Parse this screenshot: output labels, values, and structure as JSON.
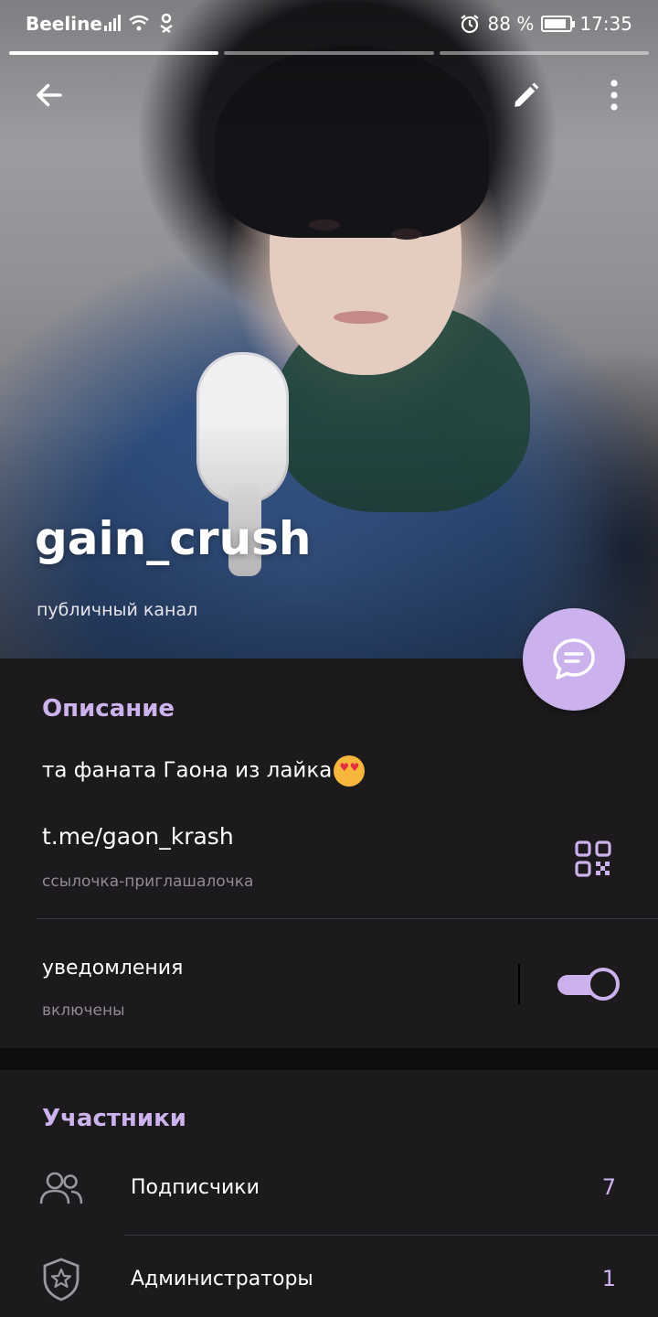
{
  "status_bar": {
    "carrier": "Beeline",
    "battery_percent": "88 %",
    "battery_level": 0.88,
    "time": "17:35"
  },
  "story_progress": {
    "segments": 3,
    "active_index": 0
  },
  "header": {
    "title": "gain_crush",
    "subtitle": "публичный канал"
  },
  "info": {
    "section_title": "Описание",
    "description": "та фаната Гаона из лайка",
    "link": "t.me/gaon_krash",
    "link_caption": "ссылочка-приглашалочка",
    "notifications_label": "уведомления",
    "notifications_state": "включены",
    "notifications_on": true
  },
  "members": {
    "section_title": "Участники",
    "rows": [
      {
        "label": "Подписчики",
        "count": "7",
        "icon": "people-icon"
      },
      {
        "label": "Администраторы",
        "count": "1",
        "icon": "shield-star-icon"
      }
    ]
  },
  "colors": {
    "accent": "#cdb3ee",
    "background": "#1c1a1d",
    "secondary_text": "#8f8a95"
  }
}
